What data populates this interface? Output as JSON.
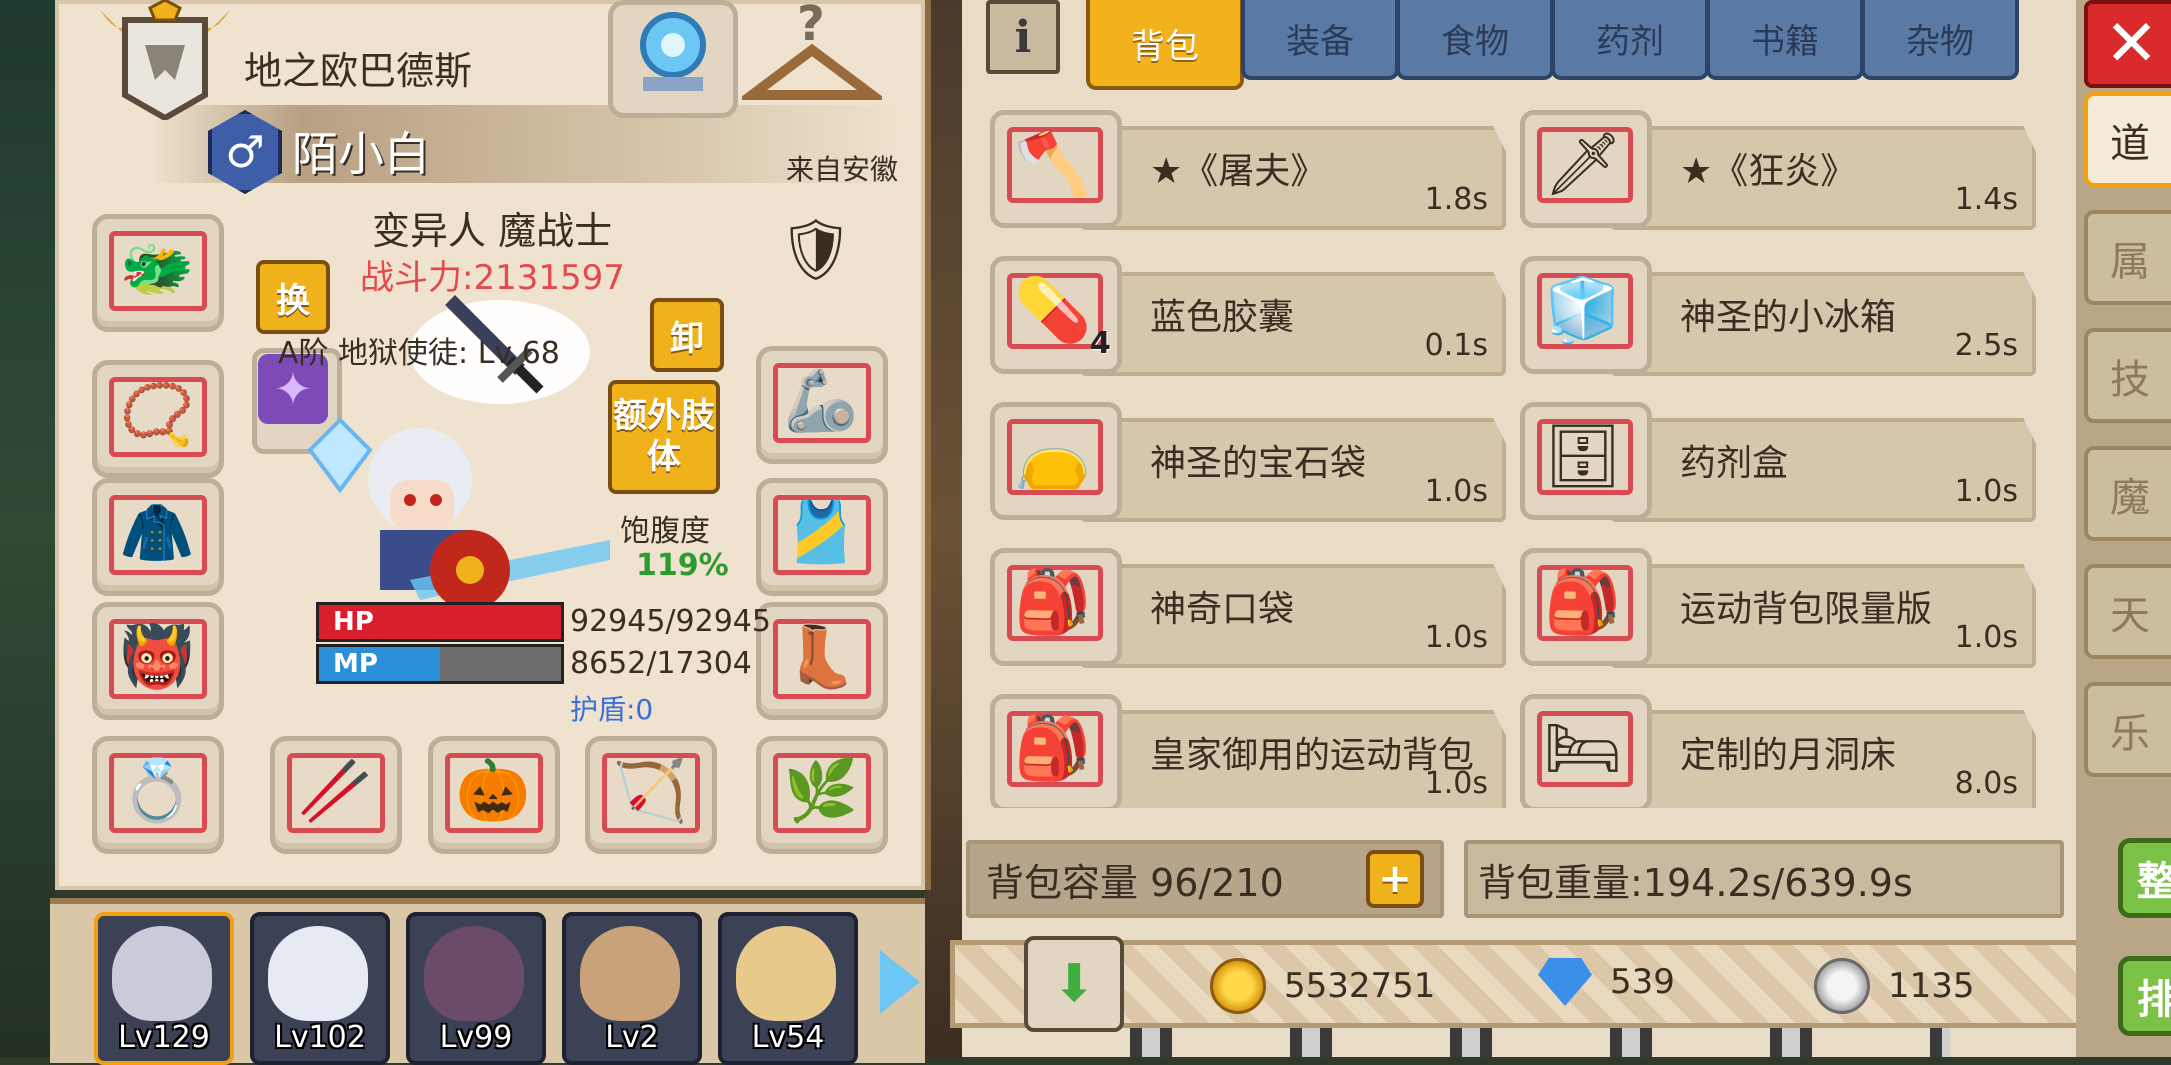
{
  "character": {
    "title": "地之欧巴德斯",
    "name": "陌小白",
    "origin": "来自安徽",
    "race_class": "变异人 魔战士",
    "power": "战斗力:2131597",
    "swap_button": "换",
    "unequip_button": "卸",
    "extra_limb_button": "额外肢体",
    "pet_label": "A阶 地狱使徒: Lv 68",
    "satiety_label": "饱腹度",
    "satiety_value": "119%",
    "satiety_fraction": 1.19,
    "hp_label": "HP",
    "hp_value": "92945/92945",
    "hp_fraction": 1.0,
    "mp_label": "MP",
    "mp_value": "8652/17304",
    "mp_fraction": 0.5,
    "shield": "护盾:0",
    "colors": {
      "power": "#e5484d",
      "satiety": "#2f9a2f",
      "shield": "#3a6fd8",
      "hp": "#d91f2e",
      "mp": "#2a8fd8"
    }
  },
  "equipment_slots": [
    {
      "name": "helmet-dragon",
      "icon": "dragon-helmet-icon"
    },
    {
      "name": "necklace",
      "icon": "necklace-icon"
    },
    {
      "name": "cape",
      "icon": "red-cape-icon"
    },
    {
      "name": "armor",
      "icon": "demon-armor-icon"
    },
    {
      "name": "ring-left",
      "icon": "gold-ring-icon"
    },
    {
      "name": "staff",
      "icon": "staff-icon"
    },
    {
      "name": "pumpkin",
      "icon": "pumpkin-icon"
    },
    {
      "name": "bow",
      "icon": "bow-icon"
    },
    {
      "name": "ring-right",
      "icon": "wreath-ring-icon"
    },
    {
      "name": "boots",
      "icon": "boots-icon"
    },
    {
      "name": "belt",
      "icon": "belt-icon"
    },
    {
      "name": "gauntlet",
      "icon": "gauntlet-icon"
    },
    {
      "name": "crest",
      "icon": "crest-icon"
    }
  ],
  "party": [
    {
      "lv": "Lv129",
      "color": "#c9ccd8"
    },
    {
      "lv": "Lv102",
      "color": "#e6eaf2"
    },
    {
      "lv": "Lv99",
      "color": "#6b4a6a"
    },
    {
      "lv": "Lv2",
      "color": "#c9a27a"
    },
    {
      "lv": "Lv54",
      "color": "#e7c98c"
    }
  ],
  "tabs": [
    "背包",
    "装备",
    "食物",
    "药剂",
    "书籍",
    "杂物"
  ],
  "info_button": "i",
  "inventory": [
    {
      "name": "★《屠夫》",
      "weight": "1.8s",
      "icon": "axe-icon",
      "qty": ""
    },
    {
      "name": "★《狂炎》",
      "weight": "1.4s",
      "icon": "sword-icon",
      "qty": ""
    },
    {
      "name": "蓝色胶囊",
      "weight": "0.1s",
      "icon": "capsule-icon",
      "qty": "4"
    },
    {
      "name": "神圣的小冰箱",
      "weight": "2.5s",
      "icon": "fridge-icon",
      "qty": ""
    },
    {
      "name": "神圣的宝石袋",
      "weight": "1.0s",
      "icon": "gem-bag-icon",
      "qty": ""
    },
    {
      "name": "药剂盒",
      "weight": "1.0s",
      "icon": "potion-box-icon",
      "qty": ""
    },
    {
      "name": "神奇口袋",
      "weight": "1.0s",
      "icon": "pouch-icon",
      "qty": ""
    },
    {
      "name": "运动背包限量版",
      "weight": "1.0s",
      "icon": "backpack-icon",
      "qty": ""
    },
    {
      "name": "皇家御用的运动背包",
      "weight": "1.0s",
      "icon": "royal-backpack-icon",
      "qty": ""
    },
    {
      "name": "定制的月洞床",
      "weight": "8.0s",
      "icon": "bed-icon",
      "qty": ""
    }
  ],
  "capacity": "背包容量 96/210",
  "weight": "背包重量:194.2s/639.9s",
  "currency": {
    "gold": "5532751",
    "diamond": "539",
    "silver": "1135"
  },
  "side_tabs": [
    "道",
    "属",
    "技",
    "魔",
    "天",
    "乐"
  ],
  "side_buttons": [
    "整",
    "排"
  ]
}
